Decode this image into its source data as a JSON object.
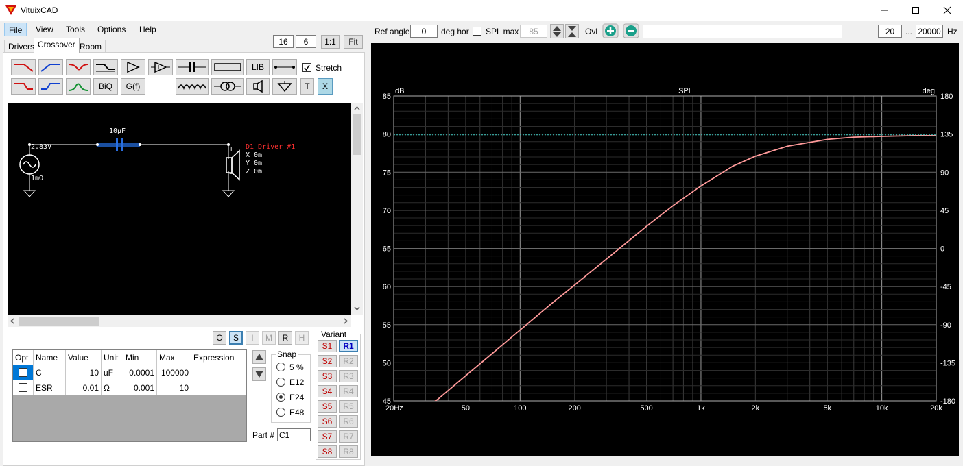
{
  "window": {
    "title": "VituixCAD"
  },
  "menu": [
    "File",
    "View",
    "Tools",
    "Options",
    "Help"
  ],
  "view_controls": {
    "a": "16",
    "b": "6",
    "ratio": "1:1",
    "fit": "Fit"
  },
  "tabs": [
    "Drivers",
    "Crossover",
    "Room"
  ],
  "toolbar": {
    "lib": "LIB",
    "stretch": "Stretch",
    "biq": "BiQ",
    "gf": "G(f)",
    "t": "T",
    "x": "X"
  },
  "schematic": {
    "source_voltage": "2.83V",
    "source_impedance": "1mΩ",
    "capacitor_label": "10µF",
    "driver_name": "D1 Driver #1",
    "driver_x": "X 0m",
    "driver_y": "Y 0m",
    "driver_z": "Z 0m",
    "plus": "+",
    "minus": "−"
  },
  "mode_buttons": [
    "O",
    "S",
    "I",
    "M",
    "R",
    "H"
  ],
  "table": {
    "headers": [
      "Opt",
      "Name",
      "Value",
      "Unit",
      "Min",
      "Max",
      "Expression"
    ],
    "rows": [
      {
        "name": "C",
        "value": "10",
        "unit": "uF",
        "min": "0.0001",
        "max": "100000",
        "expr": ""
      },
      {
        "name": "ESR",
        "value": "0.01",
        "unit": "Ω",
        "min": "0.001",
        "max": "10",
        "expr": ""
      }
    ]
  },
  "snap": {
    "label": "Snap",
    "options": [
      "5 %",
      "E12",
      "E24",
      "E48"
    ],
    "selected": "E24"
  },
  "part": {
    "label": "Part #",
    "value": "C1"
  },
  "variant": {
    "label": "Variant",
    "s": [
      "S1",
      "S2",
      "S3",
      "S4",
      "S5",
      "S6",
      "S7",
      "S8"
    ],
    "r": [
      "R1",
      "R2",
      "R3",
      "R4",
      "R5",
      "R6",
      "R7",
      "R8"
    ],
    "selected_r": "R1"
  },
  "chart_controls": {
    "ref_angle_label": "Ref angle",
    "ref_angle_value": "0",
    "deg_hor": "deg hor",
    "spl_max_label": "SPL max",
    "spl_max_value": "85",
    "ovl": "Ovl",
    "freq_min": "20",
    "freq_sep": "...",
    "freq_max": "20000",
    "freq_unit": "Hz"
  },
  "chart_data": {
    "type": "line",
    "title": "SPL",
    "ylabel": "dB",
    "y2label": "deg",
    "x_scale": "log",
    "xlim": [
      20,
      20000
    ],
    "ylim": [
      45,
      85
    ],
    "y2lim": [
      -180,
      180
    ],
    "x_tick_labels": [
      {
        "v": 20,
        "t": "20Hz"
      },
      {
        "v": 50,
        "t": "50"
      },
      {
        "v": 100,
        "t": "100"
      },
      {
        "v": 200,
        "t": "200"
      },
      {
        "v": 500,
        "t": "500"
      },
      {
        "v": 1000,
        "t": "1k"
      },
      {
        "v": 2000,
        "t": "2k"
      },
      {
        "v": 5000,
        "t": "5k"
      },
      {
        "v": 10000,
        "t": "10k"
      },
      {
        "v": 20000,
        "t": "20k"
      }
    ],
    "y_ticks": [
      85,
      80,
      75,
      70,
      65,
      60,
      55,
      50,
      45
    ],
    "y2_ticks": [
      180,
      135,
      90,
      45,
      0,
      -45,
      -90,
      -135,
      -180
    ],
    "grid": true,
    "series": [
      {
        "color": "#ff9a9a",
        "x": [
          20,
          35,
          50,
          70,
          100,
          150,
          200,
          300,
          500,
          700,
          1000,
          1500,
          2000,
          3000,
          5000,
          7000,
          10000,
          15000,
          20000
        ],
        "y": [
          41.5,
          45.2,
          48.3,
          51.2,
          54.3,
          57.8,
          60.2,
          63.6,
          67.9,
          70.6,
          73.2,
          75.8,
          77.1,
          78.4,
          79.3,
          79.6,
          79.7,
          79.8,
          79.8
        ]
      },
      {
        "color": "#3fc7c0",
        "dashed": true,
        "x": [
          20,
          20000
        ],
        "y": [
          79.9,
          79.9
        ]
      }
    ]
  }
}
